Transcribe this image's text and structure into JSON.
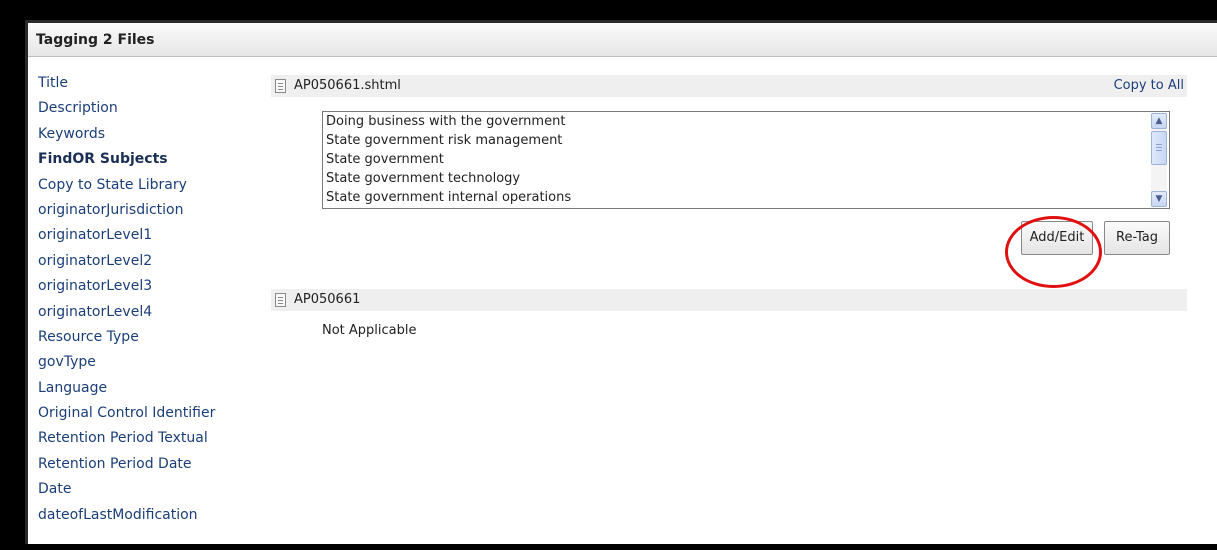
{
  "window": {
    "title": "Tagging 2 Files"
  },
  "sidebar": {
    "items": [
      {
        "label": "Title"
      },
      {
        "label": "Description"
      },
      {
        "label": "Keywords"
      },
      {
        "label": "FindOR Subjects"
      },
      {
        "label": "Copy to State Library"
      },
      {
        "label": "originatorJurisdiction"
      },
      {
        "label": "originatorLevel1"
      },
      {
        "label": "originatorLevel2"
      },
      {
        "label": "originatorLevel3"
      },
      {
        "label": "originatorLevel4"
      },
      {
        "label": "Resource Type"
      },
      {
        "label": "govType"
      },
      {
        "label": "Language"
      },
      {
        "label": "Original Control Identifier"
      },
      {
        "label": "Retention Period Textual"
      },
      {
        "label": "Retention Period Date"
      },
      {
        "label": "Date"
      },
      {
        "label": "dateofLastModification"
      }
    ],
    "active_item": "FindOR Subjects"
  },
  "files": [
    {
      "name": "AP050661.shtml",
      "copy_to_all_label": "Copy to All",
      "subjects": [
        "Doing business with the government",
        "State government risk management",
        "State government",
        "State government technology",
        "State government internal operations"
      ],
      "buttons": {
        "add_edit": "Add/Edit",
        "retag": "Re-Tag"
      }
    },
    {
      "name": "AP050661",
      "status": "Not Applicable"
    }
  ],
  "colors": {
    "link": "#1c3e78",
    "highlight_oval": "#e01010",
    "filebar_bg": "#efefef"
  },
  "icons": {
    "file": "document-icon",
    "scroll_up": "scroll-up-icon",
    "scroll_down": "scroll-down-icon"
  }
}
